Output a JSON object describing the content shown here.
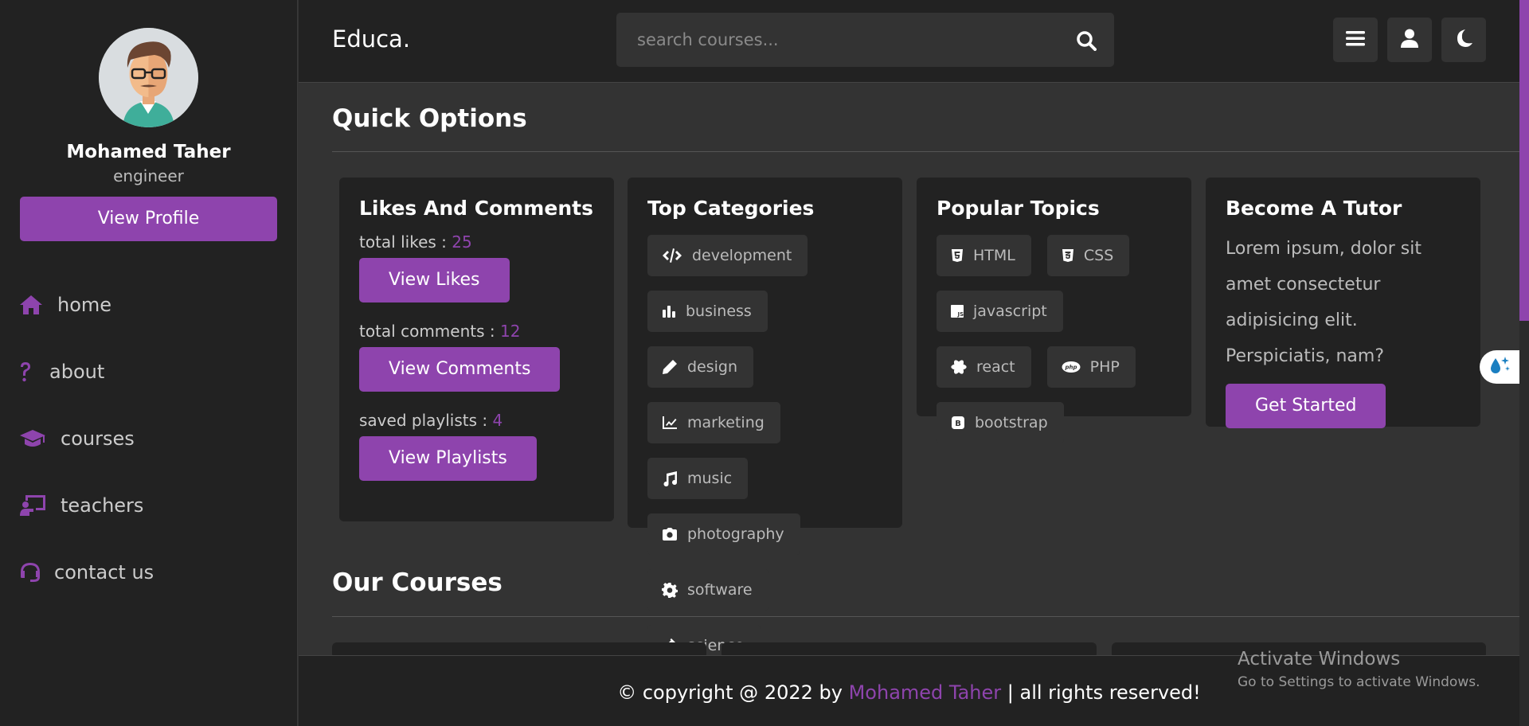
{
  "sidebar": {
    "profile": {
      "name": "Mohamed Taher",
      "role": "engineer",
      "button": "View Profile"
    },
    "nav": [
      {
        "label": "home",
        "icon": "home-icon"
      },
      {
        "label": "about",
        "icon": "question-icon"
      },
      {
        "label": "courses",
        "icon": "graduation-cap-icon"
      },
      {
        "label": "teachers",
        "icon": "chalkboard-teacher-icon"
      },
      {
        "label": "contact us",
        "icon": "headset-icon"
      }
    ]
  },
  "header": {
    "logo": "Educa.",
    "search_placeholder": "search courses...",
    "buttons": [
      "menu-icon",
      "user-icon",
      "moon-icon"
    ]
  },
  "main": {
    "quick_title": "Quick Options",
    "likes_card": {
      "title": "Likes And Comments",
      "likes_label": "total likes : ",
      "likes_value": "25",
      "likes_button": "View Likes",
      "comments_label": "total comments : ",
      "comments_value": "12",
      "comments_button": "View Comments",
      "playlists_label": "saved playlists : ",
      "playlists_value": "4",
      "playlists_button": "View Playlists"
    },
    "categories_card": {
      "title": "Top Categories",
      "tags": [
        {
          "label": "development",
          "icon": "code-icon"
        },
        {
          "label": "business",
          "icon": "chart-bar-icon"
        },
        {
          "label": "design",
          "icon": "pen-icon"
        },
        {
          "label": "marketing",
          "icon": "chart-line-icon"
        },
        {
          "label": "music",
          "icon": "music-icon"
        },
        {
          "label": "photography",
          "icon": "camera-icon"
        },
        {
          "label": "software",
          "icon": "cog-icon"
        },
        {
          "label": "science",
          "icon": "vial-icon"
        }
      ]
    },
    "topics_card": {
      "title": "Popular Topics",
      "tags": [
        {
          "label": "HTML",
          "icon": "html5-icon"
        },
        {
          "label": "CSS",
          "icon": "css3-icon"
        },
        {
          "label": "javascript",
          "icon": "js-icon"
        },
        {
          "label": "react",
          "icon": "react-icon"
        },
        {
          "label": "PHP",
          "icon": "php-icon"
        },
        {
          "label": "bootstrap",
          "icon": "bootstrap-icon"
        }
      ]
    },
    "tutor_card": {
      "title": "Become A Tutor",
      "text": "Lorem ipsum, dolor sit amet consectetur adipisicing elit. Perspiciatis, nam?",
      "button": "Get Started"
    },
    "courses_title": "Our Courses"
  },
  "footer": {
    "prefix": "© copyright @ 2022 by ",
    "name": "Mohamed Taher",
    "suffix": " | all rights reserved!"
  },
  "watermark": {
    "line1": "Activate Windows",
    "line2": "Go to Settings to activate Windows."
  },
  "colors": {
    "accent": "#8e44ad",
    "background": "#333333",
    "panel": "#222222"
  }
}
